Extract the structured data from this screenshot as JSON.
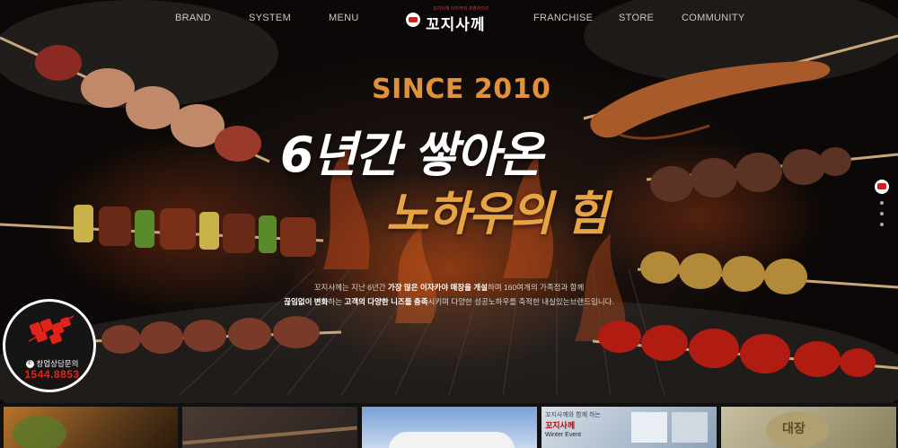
{
  "nav": {
    "left": [
      "BRAND",
      "SYSTEM",
      "MENU"
    ],
    "right": [
      "FRANCHISE",
      "STORE",
      "COMMUNITY"
    ],
    "logo": {
      "text": "꼬지사께",
      "tagline": "꼬지사께 이자카야 프랜차이즈"
    }
  },
  "hero": {
    "since": "SINCE 2010",
    "headline_1": "6년간 쌓아온",
    "headline_2": "노하우의 힘",
    "desc_line1": {
      "pre": "꼬지사께는 지난 6년간 ",
      "b1": "가장 많은 이자카야 매장을 개설",
      "post": "하며 160여개의 가족점과 함께"
    },
    "desc_line2": {
      "b1": "끊임없이 변화",
      "mid1": "하는 ",
      "b2": "고객의 다양한 니즈를 충족",
      "post": "시키며 다양한 성공노하우를 축적한 내실있는브랜드입니다."
    }
  },
  "consult": {
    "label": "창업상담문의",
    "phone": "1544.8853"
  },
  "thumbs": [
    {
      "name": "thumb-food"
    },
    {
      "name": "thumb-skewer"
    },
    {
      "name": "thumb-sky"
    },
    {
      "name": "thumb-winter-event",
      "text1": "꼬지사께와 함께 하는",
      "text2": "꼬지사께",
      "text3": "Winter Event"
    },
    {
      "name": "thumb-sign",
      "text1": "대장"
    }
  ],
  "colors": {
    "accent_red": "#e2231a",
    "gold": "#e0913a",
    "background": "#0a0706"
  }
}
